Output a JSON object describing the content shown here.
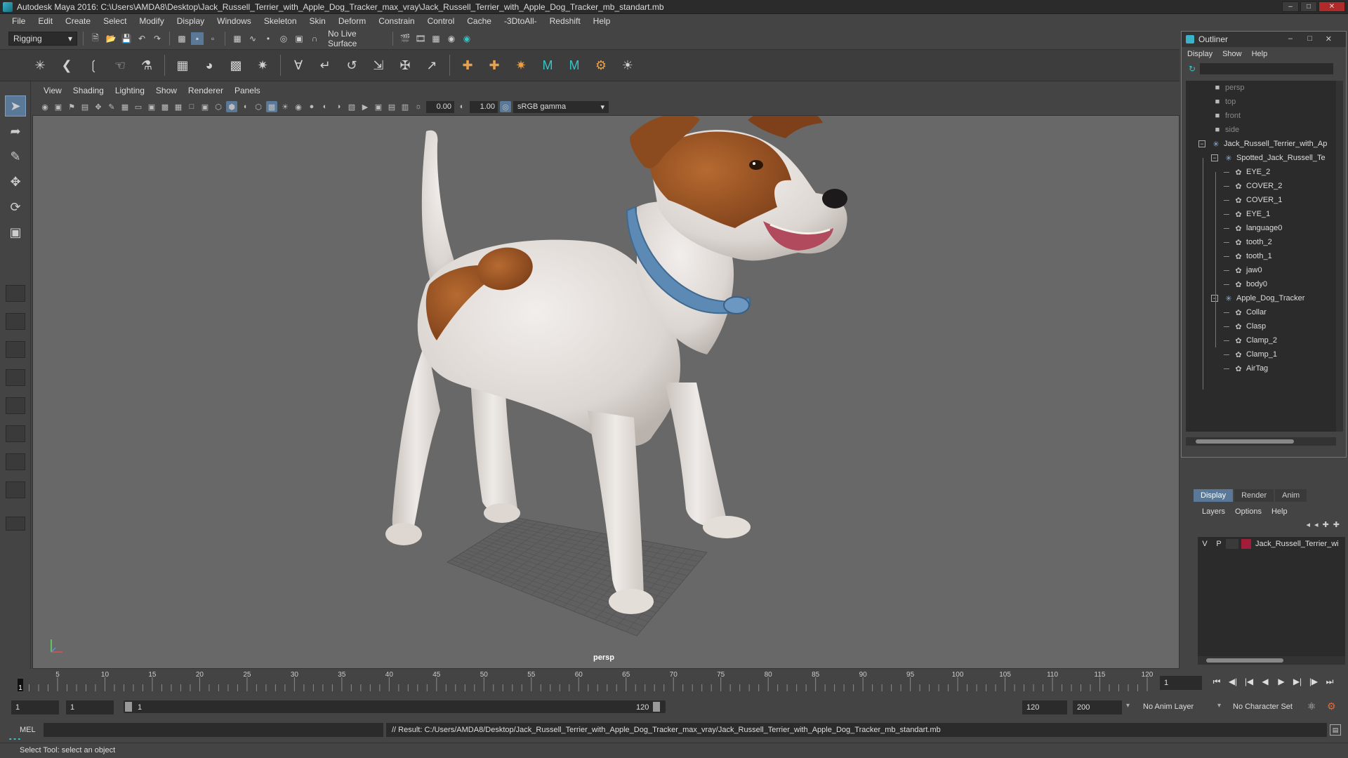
{
  "window": {
    "title": "Autodesk Maya 2016: C:\\Users\\AMDA8\\Desktop\\Jack_Russell_Terrier_with_Apple_Dog_Tracker_max_vray\\Jack_Russell_Terrier_with_Apple_Dog_Tracker_mb_standart.mb",
    "buttons": [
      "minimize-icon",
      "restore-icon",
      "close-icon"
    ]
  },
  "menubar": [
    "File",
    "Edit",
    "Create",
    "Select",
    "Modify",
    "Display",
    "Windows",
    "Skeleton",
    "Skin",
    "Deform",
    "Constrain",
    "Control",
    "Cache",
    "-3DtoAll-",
    "Redshift",
    "Help"
  ],
  "statusline": {
    "menuset": "Rigging",
    "live_surface": "No Live Surface"
  },
  "viewport": {
    "panel_menu": [
      "View",
      "Shading",
      "Lighting",
      "Show",
      "Renderer",
      "Panels"
    ],
    "exposure": "0.00",
    "gamma": "1.00",
    "color_space": "sRGB gamma",
    "camera_label": "persp",
    "colors": {
      "background": "#686868",
      "dog_fur_white": "#e9e4e1",
      "dog_fur_brown": "#9b5424",
      "collar": "#5d8ab4"
    }
  },
  "outliner": {
    "title": "Outliner",
    "menu": [
      "Display",
      "Show",
      "Help"
    ],
    "items": [
      {
        "label": "persp",
        "icon": "camera-icon",
        "dim": true
      },
      {
        "label": "top",
        "icon": "camera-icon",
        "dim": true
      },
      {
        "label": "front",
        "icon": "camera-icon",
        "dim": true
      },
      {
        "label": "side",
        "icon": "camera-icon",
        "dim": true
      },
      {
        "label": "Jack_Russell_Terrier_with_Ap",
        "icon": "group-icon",
        "expand": "−"
      },
      {
        "label": "Spotted_Jack_Russell_Te",
        "icon": "group-icon",
        "expand": "−"
      },
      {
        "label": "EYE_2",
        "icon": "mesh-icon"
      },
      {
        "label": "COVER_2",
        "icon": "mesh-icon"
      },
      {
        "label": "COVER_1",
        "icon": "mesh-icon"
      },
      {
        "label": "EYE_1",
        "icon": "mesh-icon"
      },
      {
        "label": "language0",
        "icon": "mesh-icon"
      },
      {
        "label": "tooth_2",
        "icon": "mesh-icon"
      },
      {
        "label": "tooth_1",
        "icon": "mesh-icon"
      },
      {
        "label": "jaw0",
        "icon": "mesh-icon"
      },
      {
        "label": "body0",
        "icon": "mesh-icon"
      },
      {
        "label": "Apple_Dog_Tracker",
        "icon": "group-icon",
        "expand": "−"
      },
      {
        "label": "Collar",
        "icon": "mesh-icon"
      },
      {
        "label": "Clasp",
        "icon": "mesh-icon"
      },
      {
        "label": "Clamp_2",
        "icon": "mesh-icon"
      },
      {
        "label": "Clamp_1",
        "icon": "mesh-icon"
      },
      {
        "label": "AirTag",
        "icon": "mesh-icon"
      }
    ]
  },
  "layer_editor": {
    "tabs": [
      "Display",
      "Render",
      "Anim"
    ],
    "menu": [
      "Layers",
      "Options",
      "Help"
    ],
    "layer": {
      "v": "V",
      "p": "P",
      "name": "Jack_Russell_Terrier_wi",
      "color": "#a11d3a"
    }
  },
  "timeline": {
    "ticks": [
      5,
      10,
      15,
      20,
      25,
      30,
      35,
      40,
      45,
      50,
      55,
      60,
      65,
      70,
      75,
      80,
      85,
      90,
      95,
      100,
      105,
      110,
      115,
      120
    ],
    "start_label": "1",
    "range_max": 120,
    "current_frame": "1"
  },
  "range": {
    "start": "1",
    "playback_start": "1",
    "range_start_label": "1",
    "range_end_label": "120",
    "playback_end": "120",
    "end": "200",
    "anim_layer": "No Anim Layer",
    "character_set": "No Character Set"
  },
  "commandline": {
    "label": "MEL",
    "result": "// Result: C:/Users/AMDA8/Desktop/Jack_Russell_Terrier_with_Apple_Dog_Tracker_max_vray/Jack_Russell_Terrier_with_Apple_Dog_Tracker_mb_standart.mb"
  },
  "helpline": "Select Tool: select an object"
}
